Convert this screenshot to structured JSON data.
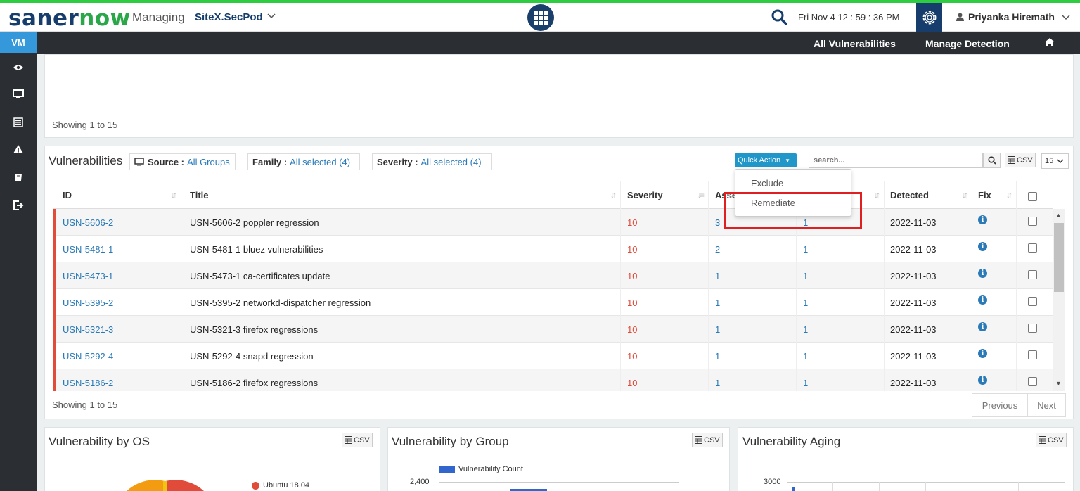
{
  "header": {
    "logo_part1": "saner",
    "logo_part2": "now",
    "managing_label": "Managing",
    "site_name": "SiteX.SecPod",
    "datetime": "Fri Nov 4  12 : 59 : 36 PM",
    "user_name": "Priyanka Hiremath"
  },
  "sidebar": {
    "active_tab": "VM",
    "icons": [
      "eye-icon",
      "monitor-icon",
      "list-icon",
      "warning-icon",
      "book-icon",
      "logout-icon"
    ]
  },
  "subnav": {
    "links": [
      "All Vulnerabilities",
      "Manage Detection"
    ]
  },
  "top_panel": {
    "showing": "Showing 1 to 15"
  },
  "vulnerabilities": {
    "title": "Vulnerabilities",
    "filters": [
      {
        "label": "Source :",
        "value": "All Groups"
      },
      {
        "label": "Family :",
        "value": "All selected (4)"
      },
      {
        "label": "Severity :",
        "value": "All selected (4)"
      }
    ],
    "quick_action_label": "Quick Action",
    "search_placeholder": "search...",
    "csv_label": "CSV",
    "page_size": "15",
    "columns": [
      "ID",
      "Title",
      "Severity",
      "Asse",
      "",
      "Detected",
      "Fix"
    ],
    "rows": [
      {
        "id": "USN-5606-2",
        "title": "USN-5606-2 poppler regression",
        "severity": "10",
        "assets": "3",
        "groups": "1",
        "detected": "2022-11-03"
      },
      {
        "id": "USN-5481-1",
        "title": "USN-5481-1 bluez vulnerabilities",
        "severity": "10",
        "assets": "2",
        "groups": "1",
        "detected": "2022-11-03"
      },
      {
        "id": "USN-5473-1",
        "title": "USN-5473-1 ca-certificates update",
        "severity": "10",
        "assets": "1",
        "groups": "1",
        "detected": "2022-11-03"
      },
      {
        "id": "USN-5395-2",
        "title": "USN-5395-2 networkd-dispatcher regression",
        "severity": "10",
        "assets": "1",
        "groups": "1",
        "detected": "2022-11-03"
      },
      {
        "id": "USN-5321-3",
        "title": "USN-5321-3 firefox regressions",
        "severity": "10",
        "assets": "1",
        "groups": "1",
        "detected": "2022-11-03"
      },
      {
        "id": "USN-5292-4",
        "title": "USN-5292-4 snapd regression",
        "severity": "10",
        "assets": "1",
        "groups": "1",
        "detected": "2022-11-03"
      },
      {
        "id": "USN-5186-2",
        "title": "USN-5186-2 firefox regressions",
        "severity": "10",
        "assets": "1",
        "groups": "1",
        "detected": "2022-11-03"
      }
    ],
    "showing": "Showing 1 to 15",
    "pager": {
      "previous": "Previous",
      "next": "Next"
    },
    "dropdown": [
      "Exclude",
      "Remediate"
    ]
  },
  "widgets": {
    "os": {
      "title": "Vulnerability by OS",
      "legend": "Ubuntu 18.04"
    },
    "group": {
      "title": "Vulnerability by Group",
      "legend": "Vulnerability Count",
      "y_tick": "2,400"
    },
    "aging": {
      "title": "Vulnerability Aging",
      "y_tick": "3000"
    }
  },
  "colors": {
    "brand_dark": "#163d6b",
    "brand_green": "#2aa748",
    "severity_red": "#e04b3a",
    "link_blue": "#2a7ab8",
    "accent_blue": "#2196c9"
  }
}
